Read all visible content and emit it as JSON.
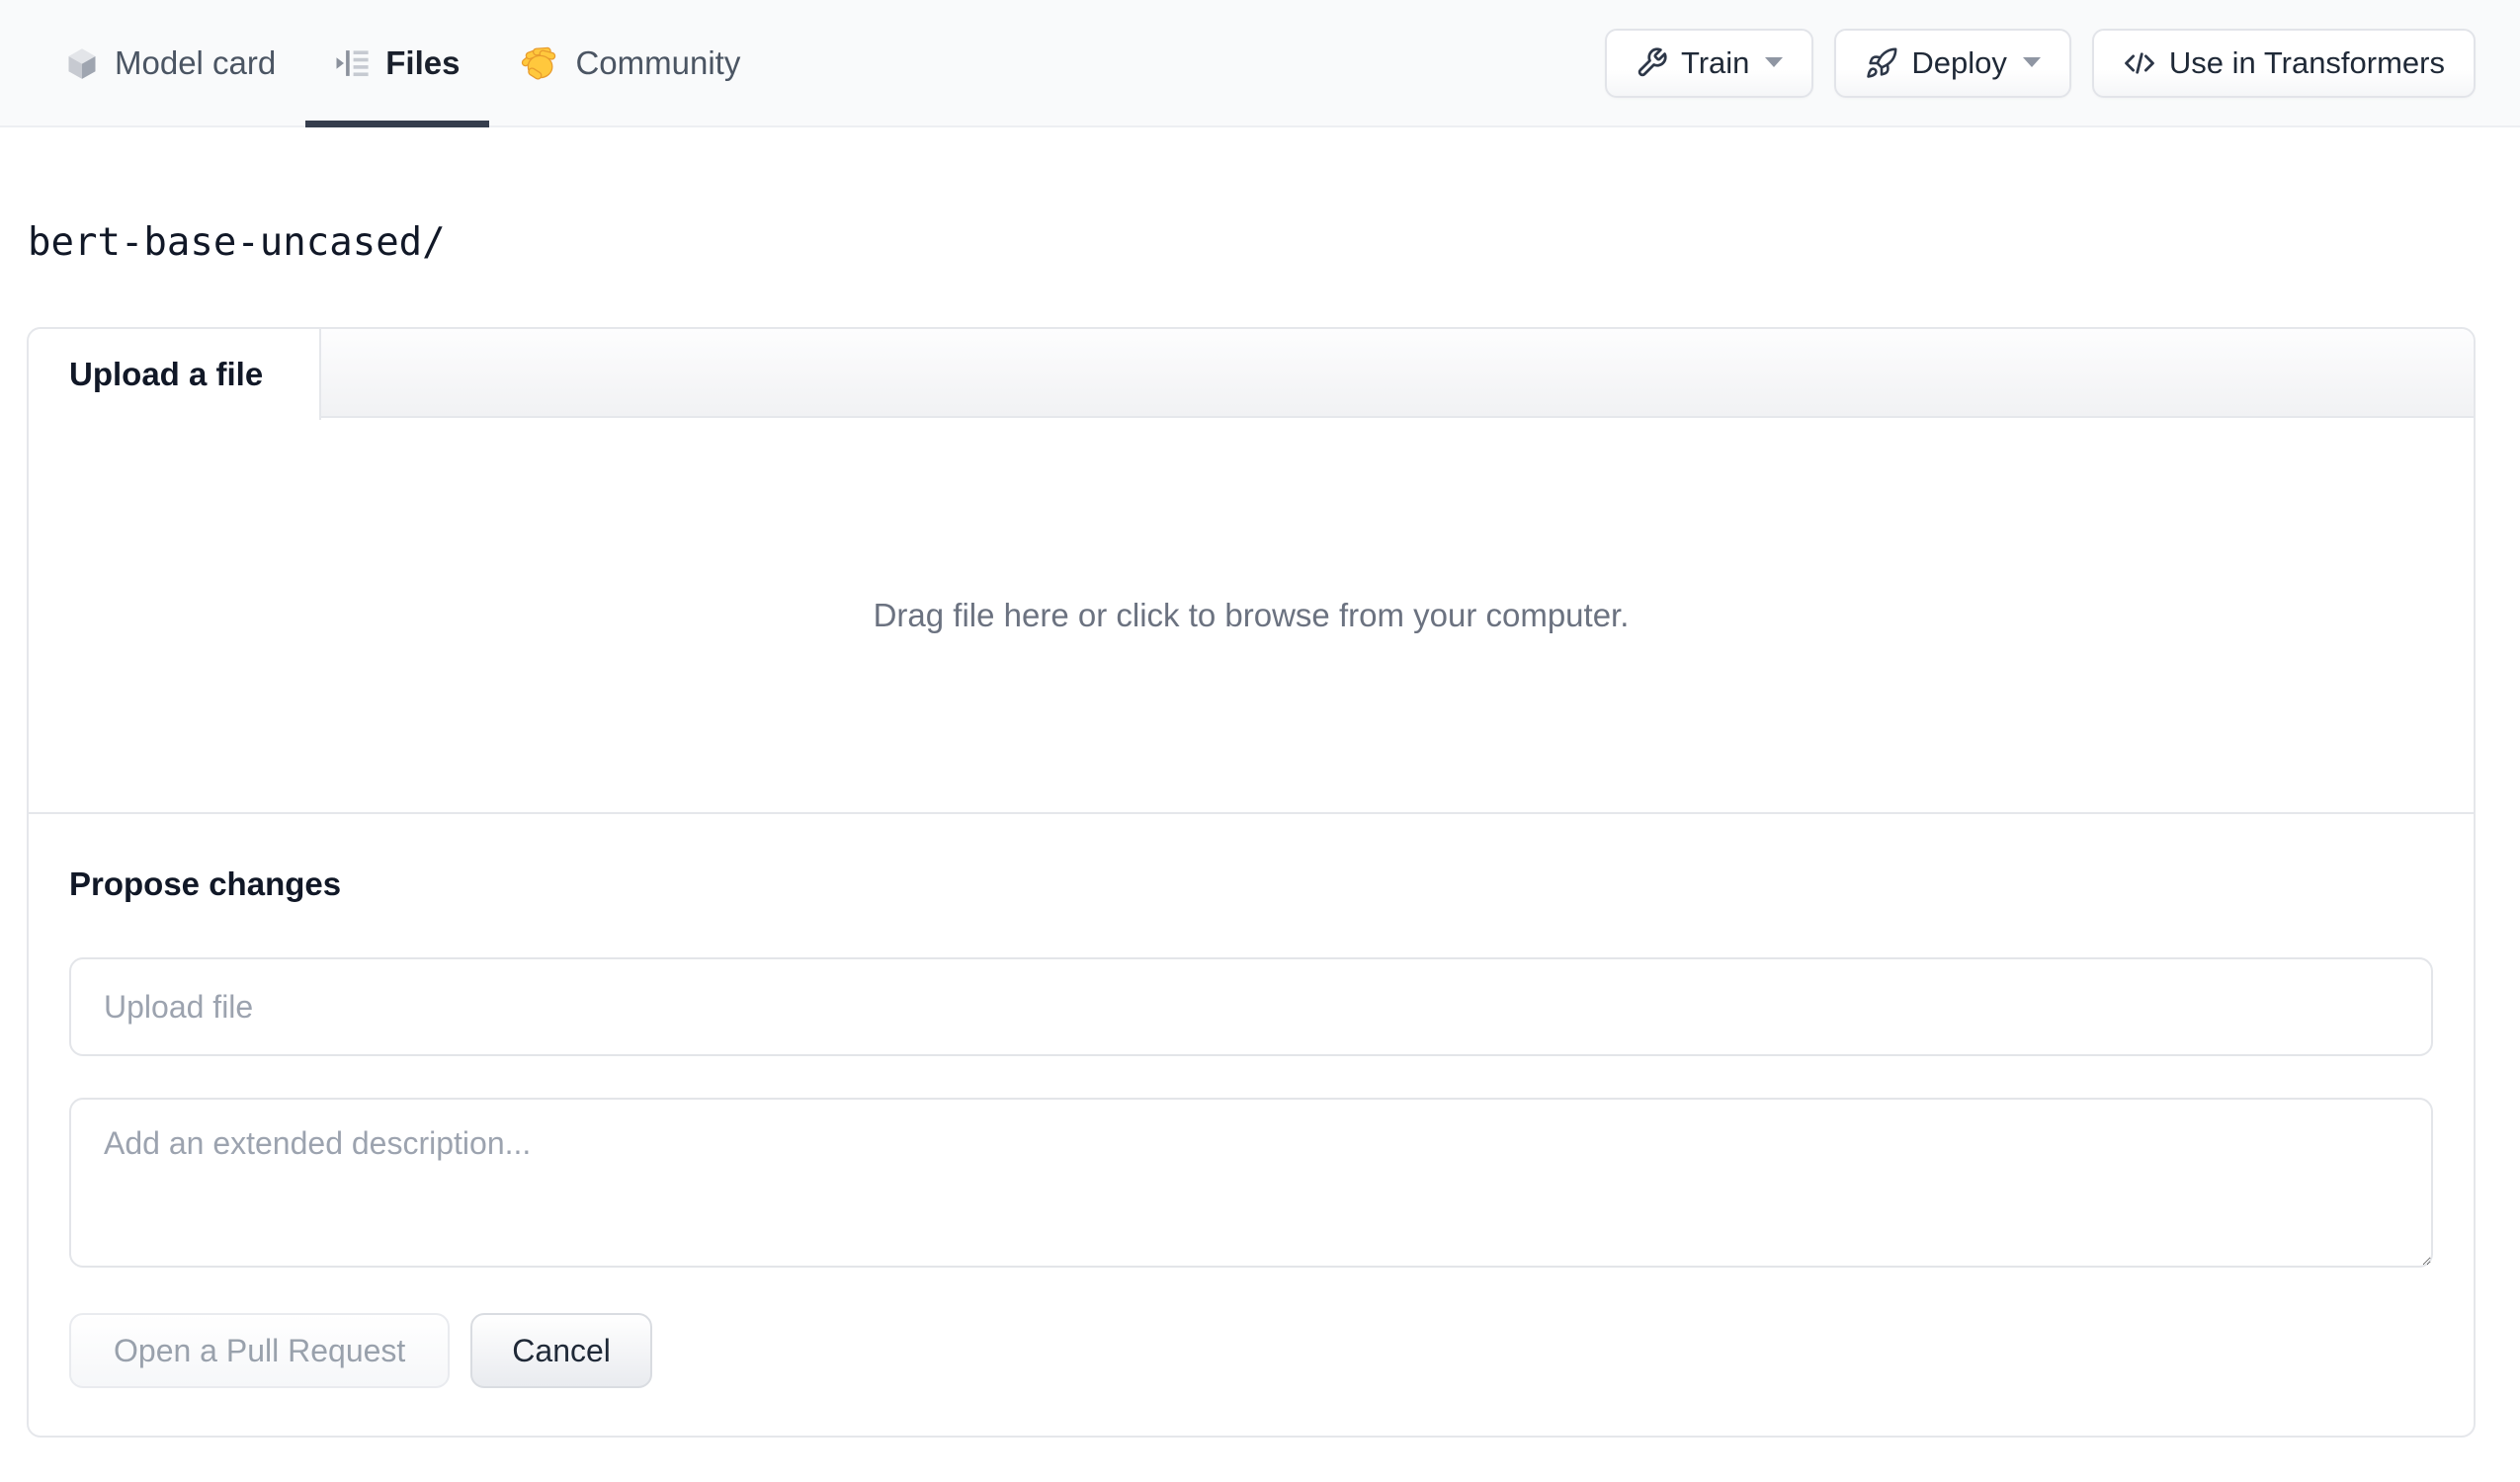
{
  "nav": {
    "tabs": [
      {
        "label": "Model card",
        "icon": "cube-icon",
        "active": false
      },
      {
        "label": "Files",
        "icon": "file-versions-icon",
        "active": true
      },
      {
        "label": "Community",
        "icon": "waving-hand-icon",
        "active": false
      }
    ],
    "actions": [
      {
        "label": "Train",
        "icon": "wrench-icon",
        "has_caret": true
      },
      {
        "label": "Deploy",
        "icon": "rocket-icon",
        "has_caret": true
      },
      {
        "label": "Use in Transformers",
        "icon": "code-icon",
        "has_caret": false
      }
    ]
  },
  "breadcrumb": {
    "path": "bert-base-uncased/"
  },
  "upload_card": {
    "tab_label": "Upload a file",
    "dropzone_text": "Drag file here or click to browse from your computer.",
    "propose": {
      "heading": "Propose changes",
      "filename_placeholder": "Upload file",
      "description_placeholder": "Add an extended description...",
      "submit_label": "Open a Pull Request",
      "cancel_label": "Cancel"
    }
  },
  "colors": {
    "nav_background": "#f9fafb",
    "active_tab_underline": "#353d4d",
    "card_border": "#e5e7eb",
    "muted_text": "#6b7280",
    "placeholder_text": "#9ca3af",
    "dark_text": "#111827",
    "wave_emoji_fill": "#ffc83d"
  }
}
